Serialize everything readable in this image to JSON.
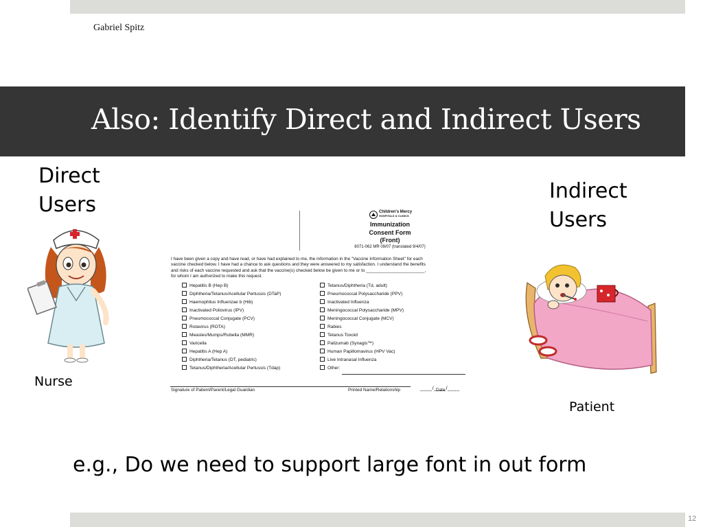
{
  "slide": {
    "author": "Gabriel Spitz",
    "title": "Also: Identify Direct and Indirect Users",
    "direct_label": "Direct Users",
    "indirect_label": "Indirect Users",
    "nurse_label": "Nurse",
    "patient_label": "Patient",
    "example_note": "e.g., Do we need to support large font in out form",
    "page_number": "12"
  },
  "form": {
    "hospital_name": "Children's Mercy",
    "hospital_sub": "HOSPITALS & CLINICS",
    "title_line1": "Immunization",
    "title_line2": "Consent Form",
    "title_line3": "(Front)",
    "form_code": "8071-062 MR 09/07 (translated 9/4/07)",
    "intro": "I have been given a copy and have read, or have had explained to me, the information in the \"Vaccine Information Sheet\" for each\nvaccine checked below.  I have had a chance to ask questions and they were answered to my satisfaction.  I understand the benefits\nand risks of each vaccine requested and ask that the vaccine(s) checked below be given to me or to ________________________,\nfor whom I am authorized to make this request.",
    "vaccines_left": [
      "Hepatitis B (Hep B)",
      "Diphtheria/Tetanus/Acellular Pertussis (DTaP)",
      "Haemophilus Influenzae b (Hib)",
      "Inactivated Poliovirus (IPV)",
      "Pneumococcal Conjugate (PCV)",
      "Rotavirus (ROTA)",
      "Measles/Mumps/Rubella (MMR)",
      "Varicella",
      "Hepatitis A (Hep A)",
      "Diphtheria/Tetanus (DT, pediatric)",
      "Tetanus/Diphtheria/Acellular Pertussis (Tdap)"
    ],
    "vaccines_right": [
      "Tetanus/Diphtheria (Td, adult)",
      "Pneumococcal Polysaccharide (PPV)",
      "Inactivated Influenza",
      "Meningococcal Polysaccharide (MPV)",
      "Meningococcal Conjugate (MCV)",
      "Rabies",
      "Tetanus Toxoid",
      "Palizumab (Synagis™)",
      "Human Papillomavirus (HPV Vac)",
      "Live Intranasal Influenza",
      "Other:"
    ],
    "date_blank": "____/____/____",
    "signature_label": "Signature of Patient/Parent/Legal Guardian",
    "name_label": "Printed Name/Relationship",
    "date_label": "Date"
  },
  "colors": {
    "title_band": "#353535",
    "accent_bar": "#dcddd9",
    "title_text": "#ffffff"
  },
  "icons": {
    "nurse": "nurse-cartoon",
    "patient": "sick-child-in-bed-cartoon",
    "hospital_logo": "hospital-logo"
  }
}
